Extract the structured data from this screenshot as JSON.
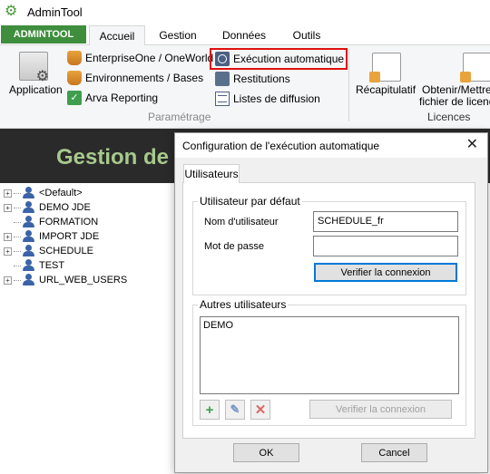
{
  "app": {
    "title": "AdminTool"
  },
  "ribbon": {
    "admintool_tab": "ADMINTOOL",
    "tabs": [
      "Accueil",
      "Gestion",
      "Données",
      "Outils"
    ],
    "application_label": "Application",
    "items": {
      "enterprise_one": "EnterpriseOne / OneWorld",
      "environnements": "Environnements / Bases",
      "arva_reporting": "Arva Reporting",
      "execution_auto": "Exécution automatique",
      "restitutions": "Restitutions",
      "listes_diffusion": "Listes de diffusion"
    },
    "group_parametrage": "Paramétrage",
    "recapitulatif": "Récapitulatif",
    "obtenir_line1": "Obtenir/Mettre",
    "obtenir_line2": "fichier de licenc",
    "group_licences": "Licences",
    "colors": {
      "admintool_green": "#3e8e3e",
      "highlight_red": "#e01010"
    }
  },
  "main": {
    "banner_title": "Gestion de",
    "tree": [
      "<Default>",
      "DEMO JDE",
      "FORMATION",
      "IMPORT JDE",
      "SCHEDULE",
      "TEST",
      "URL_WEB_USERS"
    ]
  },
  "dialog": {
    "title": "Configuration de l'exécution automatique",
    "tab": "Utilisateurs",
    "default_user": {
      "legend": "Utilisateur par défaut",
      "username_label": "Nom d'utilisateur",
      "username_value": "SCHEDULE_fr",
      "password_label": "Mot de passe",
      "password_value": "",
      "verify_button": "Verifier la connexion"
    },
    "other_users": {
      "legend": "Autres utilisateurs",
      "items": [
        "DEMO"
      ],
      "verify_button": "Verifier la connexion"
    },
    "ok_button": "OK",
    "cancel_button": "Cancel"
  }
}
